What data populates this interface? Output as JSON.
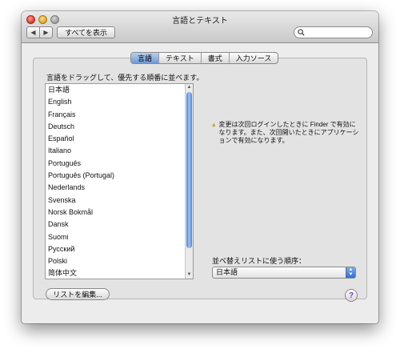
{
  "window": {
    "title": "言語とテキスト"
  },
  "toolbar": {
    "back_symbol": "◀",
    "forward_symbol": "▶",
    "show_all_label": "すべてを表示",
    "search_placeholder": ""
  },
  "tabs": [
    {
      "label": "言語",
      "active": true
    },
    {
      "label": "テキスト",
      "active": false
    },
    {
      "label": "書式",
      "active": false
    },
    {
      "label": "入力ソース",
      "active": false
    }
  ],
  "instruction": "言語をドラッグして、優先する順番に並べます。",
  "languages": [
    "日本語",
    "English",
    "Français",
    "Deutsch",
    "Español",
    "Italiano",
    "Português",
    "Português (Portugal)",
    "Nederlands",
    "Svenska",
    "Norsk Bokmål",
    "Dansk",
    "Suomi",
    "Русский",
    "Polski",
    "简体中文"
  ],
  "warning": {
    "icon": "warning-triangle-icon",
    "text": "変更は次回ログインしたときに Finder で有効になります。また、次回開いたときにアプリケーションで有効になります。"
  },
  "sort": {
    "label": "並べ替えリストに使う順序：",
    "selected": "日本語"
  },
  "edit_list_label": "リストを編集...",
  "help_symbol": "?",
  "colors": {
    "accent": "#5b8fdc",
    "warning": "#f2c12e",
    "help": "#7a3ec2"
  }
}
